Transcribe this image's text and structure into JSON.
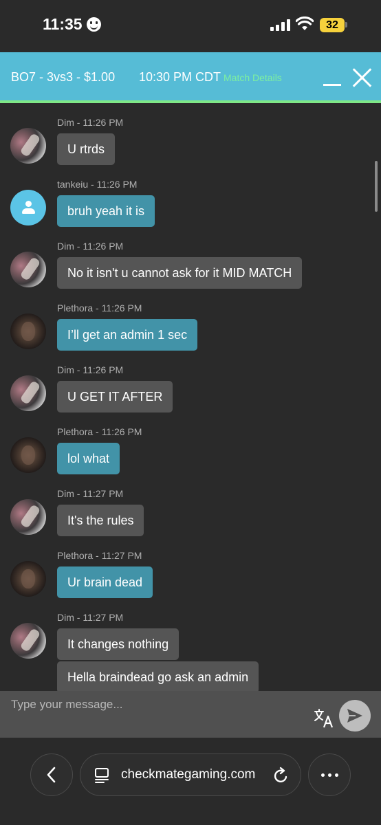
{
  "status_bar": {
    "time": "11:35",
    "battery": "32"
  },
  "header": {
    "title": "BO7 - 3vs3 - $1.00",
    "time": "10:30 PM CDT",
    "details_link": "Match Details",
    "accent_color": "#56bcd6",
    "underline_color": "#7ee787"
  },
  "messages": [
    {
      "meta": "Dim - 11:26 PM",
      "text": "U rtrds",
      "avatar": "dim",
      "style": "grey"
    },
    {
      "meta": "tankeiu - 11:26 PM",
      "text": "bruh yeah it is",
      "avatar": "default",
      "style": "blue"
    },
    {
      "meta": "Dim - 11:26 PM",
      "text": "No it isn't u cannot ask for it MID MATCH",
      "avatar": "dim",
      "style": "grey"
    },
    {
      "meta": "Plethora - 11:26 PM",
      "text": "I’ll get an admin 1 sec",
      "avatar": "plethora",
      "style": "blue"
    },
    {
      "meta": "Dim - 11:26 PM",
      "text": "U GET IT AFTER",
      "avatar": "dim",
      "style": "grey"
    },
    {
      "meta": "Plethora - 11:26 PM",
      "text": "lol what",
      "avatar": "plethora",
      "style": "blue"
    },
    {
      "meta": "Dim - 11:27 PM",
      "text": "It's the rules",
      "avatar": "dim",
      "style": "grey"
    },
    {
      "meta": "Plethora - 11:27 PM",
      "text": "Ur brain dead",
      "avatar": "plethora",
      "style": "blue"
    },
    {
      "meta": "Dim - 11:27 PM",
      "text": "It changes nothing",
      "avatar": "dim",
      "style": "grey"
    },
    {
      "meta": "",
      "text": "Hella braindead go ask an admin",
      "avatar": "none",
      "style": "grey"
    }
  ],
  "input": {
    "placeholder": "Type your message...",
    "value": ""
  },
  "browser": {
    "url": "checkmategaming.com"
  },
  "icons": {
    "translate": "translate-icon",
    "send": "send-icon",
    "back": "chevron-left-icon",
    "tabs": "tabs-icon",
    "reload": "reload-icon",
    "more": "more-icon"
  }
}
